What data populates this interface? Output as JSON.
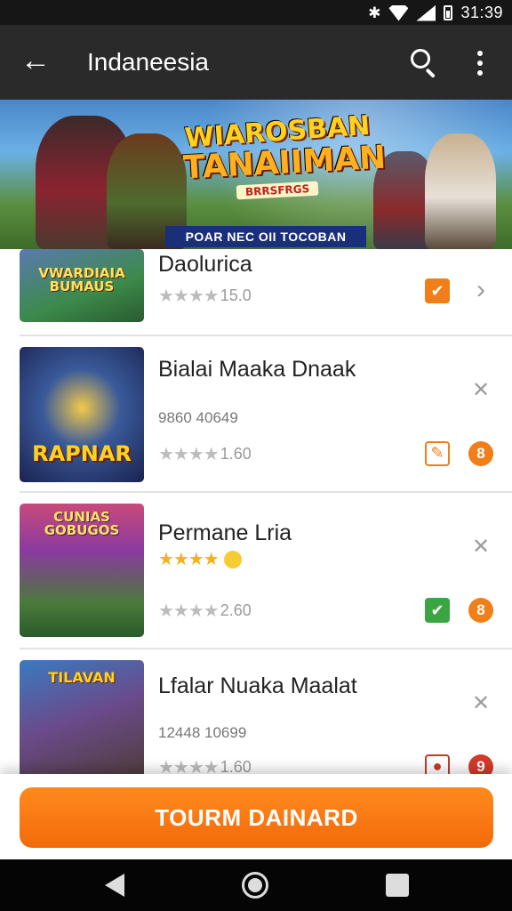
{
  "status_bar": {
    "time": "31:39",
    "bluetooth_icon": "bluetooth-icon",
    "wifi_icon": "wifi-icon",
    "signal_icon": "signal-icon",
    "battery_icon": "battery-icon"
  },
  "app_bar": {
    "title": "Indaneesia",
    "back_icon": "arrow-back-icon",
    "search_icon": "search-icon",
    "more_icon": "more-vert-icon"
  },
  "banner": {
    "title_line1": "WIAROSBAN",
    "title_line2": "TANAIIMAN",
    "badge": "BRRSFRGS",
    "strip": "POAR NEC OII TOCOBAN"
  },
  "games": [
    {
      "name": "Daolurica",
      "meta": "",
      "rating": "15.0",
      "thumb_text": "VWARDIAIA BUMAUS",
      "action_primary": "✔",
      "action_secondary": "›",
      "primary_style": "orange-square",
      "secondary_style": "chevron"
    },
    {
      "name": "Bialai Maaka Dnaak",
      "meta": "9860 40649",
      "rating": "1.60",
      "thumb_text": "RAPNAR",
      "action_primary": "✎",
      "action_secondary": "8",
      "primary_style": "outline-square",
      "secondary_style": "orange-circle",
      "pin_icon": "pin-icon"
    },
    {
      "name": "Permane Lria",
      "meta": "",
      "rating": "2.60",
      "thumb_text": "CUNIAS GOBUGOS",
      "action_primary": "✔",
      "action_secondary": "8",
      "primary_style": "green-square",
      "secondary_style": "orange-circle",
      "pin_icon": "pin-icon"
    },
    {
      "name": "Lfalar Nuaka Maalat",
      "meta": "12448 10699",
      "rating": "1.60",
      "thumb_text": "TILAVAN",
      "action_primary": "●",
      "action_secondary": "9",
      "primary_style": "outline-red-square",
      "secondary_style": "red-circle",
      "pin_icon": "pin-icon"
    }
  ],
  "download_button": {
    "label": "TOURM DAINARD"
  },
  "nav_bar": {
    "back_icon": "nav-back-icon",
    "home_icon": "nav-home-icon",
    "recent_icon": "nav-recent-icon"
  },
  "colors": {
    "accent": "#f07e19",
    "app_bar": "#2a2a2a",
    "status_bar": "#161616",
    "star": "#bcbcbc",
    "star_gold": "#f2b21a"
  }
}
